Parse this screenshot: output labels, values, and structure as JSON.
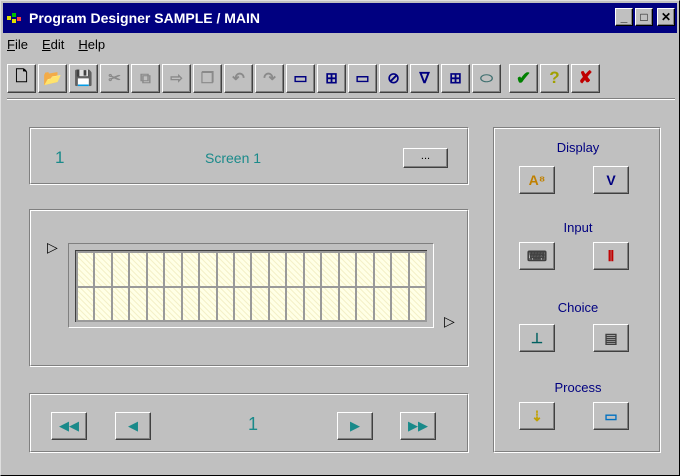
{
  "window": {
    "title": "Program Designer SAMPLE / MAIN"
  },
  "titlebar_buttons": {
    "minimize": "_",
    "maximize": "□",
    "close": "✕"
  },
  "menu": [
    {
      "accel": "F",
      "rest": "ile"
    },
    {
      "accel": "E",
      "rest": "dit"
    },
    {
      "accel": "H",
      "rest": "elp"
    }
  ],
  "toolbar": {
    "glyphs": {
      "new": "🗋",
      "open": "📂",
      "save": "💾",
      "cut": "✂",
      "copy": "⧉",
      "paste": "⇨",
      "duplicate": "❐",
      "undo": "↶",
      "redo": "↷",
      "window": "▭",
      "tree": "⊞",
      "field": "▭",
      "clear": "⊘",
      "verify": "∇",
      "grid": "⊞",
      "device": "⬭",
      "ok": "✔",
      "help": "?",
      "cancel": "✘"
    }
  },
  "screen": {
    "number": "1",
    "name": "Screen 1",
    "browse_label": "..."
  },
  "lcd": {
    "rows": 2,
    "cols": 20,
    "left_marker": "▷",
    "right_marker": "▷"
  },
  "navigation": {
    "page_number": "1",
    "first": "◀◀",
    "prev": "◀",
    "next": "▶",
    "last": "▶▶"
  },
  "side_panel": {
    "display": "Display",
    "input": "Input",
    "choice": "Choice",
    "process": "Process"
  },
  "colors": {
    "accent": "#1a8a8a",
    "label": "#000080",
    "titlebar": "#000080",
    "panel": "#c0c0c0"
  }
}
